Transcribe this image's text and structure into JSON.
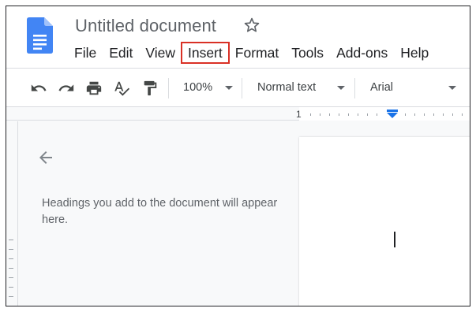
{
  "document": {
    "title": "Untitled document"
  },
  "menu": {
    "items": [
      {
        "label": "File"
      },
      {
        "label": "Edit"
      },
      {
        "label": "View"
      },
      {
        "label": "Insert",
        "highlighted": true
      },
      {
        "label": "Format"
      },
      {
        "label": "Tools"
      },
      {
        "label": "Add-ons"
      },
      {
        "label": "Help"
      }
    ]
  },
  "toolbar": {
    "undo_icon": "undo-icon",
    "redo_icon": "redo-icon",
    "print_icon": "print-icon",
    "spellcheck_icon": "spellcheck-icon",
    "paint_format_icon": "paint-format-icon",
    "zoom": "100%",
    "style": "Normal text",
    "font": "Arial"
  },
  "ruler": {
    "start_number": "1"
  },
  "outline": {
    "back_icon": "arrow-left-icon",
    "empty_message": "Headings you add to the document will appear here."
  },
  "colors": {
    "docs_blue": "#4285f4",
    "highlight_red": "#d93025",
    "ruler_marker_blue": "#1a73e8"
  }
}
